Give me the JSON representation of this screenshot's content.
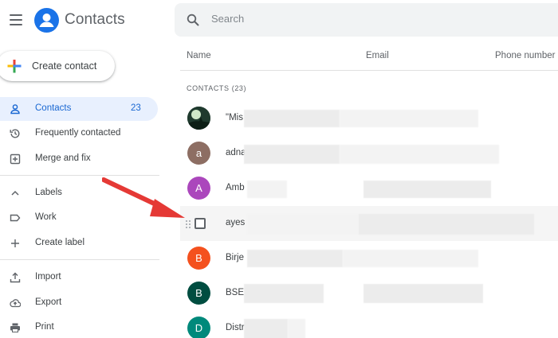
{
  "app": {
    "title": "Contacts"
  },
  "search": {
    "placeholder": "Search"
  },
  "create_button": {
    "label": "Create contact"
  },
  "sidebar": {
    "items": [
      {
        "label": "Contacts",
        "count": "23",
        "icon": "person-icon",
        "active": true
      },
      {
        "label": "Frequently contacted",
        "icon": "history-icon"
      },
      {
        "label": "Merge and fix",
        "icon": "merge-icon"
      }
    ],
    "labels_header": "Labels",
    "labels": [
      {
        "label": "Work",
        "icon": "label-icon"
      },
      {
        "label": "Create label",
        "icon": "plus-icon"
      }
    ],
    "actions": [
      {
        "label": "Import",
        "icon": "import-icon"
      },
      {
        "label": "Export",
        "icon": "export-icon"
      },
      {
        "label": "Print",
        "icon": "printer-icon"
      }
    ]
  },
  "table": {
    "columns": [
      "Name",
      "Email",
      "Phone number"
    ],
    "section_label": "CONTACTS (23)",
    "rows": [
      {
        "name": "\"Mis",
        "avatar": "",
        "avatar_color": "#2e4a3a"
      },
      {
        "name": "adna",
        "avatar": "a",
        "avatar_color": "#8d6e63"
      },
      {
        "name": "Amb",
        "avatar": "A",
        "avatar_color": "#ab47bc"
      },
      {
        "name": "ayes",
        "avatar": "",
        "avatar_color": ""
      },
      {
        "name": "Birje",
        "avatar": "B",
        "avatar_color": "#f4511e"
      },
      {
        "name": "BSE",
        "avatar": "B",
        "avatar_color": "#004d40"
      },
      {
        "name": "Distr",
        "avatar": "D",
        "avatar_color": "#00897b"
      }
    ]
  },
  "colors": {
    "accent": "#1a73e8",
    "active_bg": "#e8f0fe",
    "arrow": "#e53935"
  }
}
